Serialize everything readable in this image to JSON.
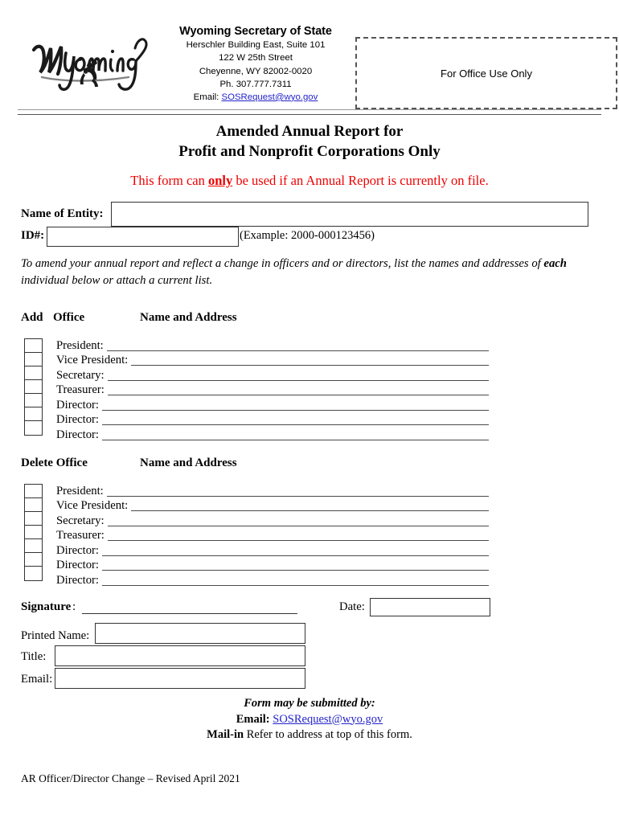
{
  "header": {
    "logo_alt": "Wyoming",
    "agency_name": "Wyoming Secretary of State",
    "address_line_1": "Herschler Building East, Suite 101",
    "address_line_2": "122 W 25th Street",
    "address_line_3": "Cheyenne, WY 82002-0020",
    "phone": "Ph. 307.777.7311",
    "email_label": "Email:",
    "email": "SOSRequest@wyo.gov",
    "office_use_only": "For Office Use Only"
  },
  "title": {
    "line1": "Amended Annual Report for",
    "line2": "Profit and Nonprofit Corporations Only",
    "warning_before": "This form can ",
    "warning_emphasis": "only",
    "warning_after": " be used if an Annual Report is currently on file."
  },
  "entity": {
    "name_label": "Name of Entity:",
    "name_value": "",
    "id_label": "ID#:",
    "id_value": "",
    "id_example": "(Example: 2000-000123456)"
  },
  "instruction": {
    "part1": "To amend your annual report and reflect a change in officers and or directors, list the names and addresses of ",
    "emphasis": "each",
    "part2": " individual below or attach a current list."
  },
  "add_section": {
    "col_add": "Add",
    "col_office": "Office",
    "col_name_address": "Name and Address",
    "rows": [
      {
        "office": "President:",
        "value": ""
      },
      {
        "office": "Vice President:",
        "value": ""
      },
      {
        "office": "Secretary:",
        "value": ""
      },
      {
        "office": "Treasurer:",
        "value": ""
      },
      {
        "office": "Director:",
        "value": ""
      },
      {
        "office": "Director:",
        "value": ""
      },
      {
        "office": "Director:",
        "value": ""
      }
    ]
  },
  "delete_section": {
    "col_add": "Delete Office",
    "col_name_address": "Name and Address",
    "rows": [
      {
        "office": "President:",
        "value": ""
      },
      {
        "office": "Vice President:",
        "value": ""
      },
      {
        "office": "Secretary:",
        "value": ""
      },
      {
        "office": "Treasurer:",
        "value": ""
      },
      {
        "office": "Director:",
        "value": ""
      },
      {
        "office": "Director:",
        "value": ""
      },
      {
        "office": "Director:",
        "value": ""
      }
    ]
  },
  "signature": {
    "signature_label": "Signature",
    "signature_colon": ":",
    "signature_value": "",
    "date_label": "Date:",
    "date_value": "",
    "printed_name_label": "Printed Name:",
    "printed_name_value": "",
    "title_label": "Title:",
    "title_value": "",
    "email_label": "Email:",
    "email_value": ""
  },
  "footer": {
    "submit_title": "Form may be submitted by:",
    "email_label": "Email:",
    "email": "SOSRequest@wyo.gov",
    "mail_label": "Mail-in",
    "mail_text": " Refer to address at top of this form.",
    "revision": "AR Officer/Director Change – Revised April 2021"
  },
  "colors": {
    "warning_red": "#ee0000",
    "link_blue": "#2424cc",
    "border": "#333333",
    "rule": "#555555"
  }
}
